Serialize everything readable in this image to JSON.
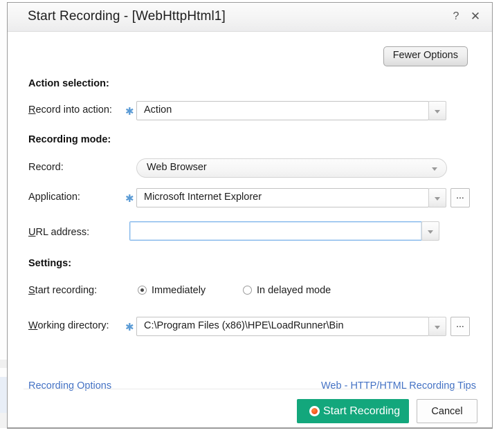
{
  "window": {
    "title": "Start Recording - [WebHttpHtml1]",
    "help_icon": "?",
    "close_icon": "✕"
  },
  "toolbar": {
    "fewer_options_label": "Fewer Options"
  },
  "sections": {
    "action_selection": {
      "heading": "Action selection:",
      "record_into_action": {
        "label_prefix": "R",
        "label_rest": "ecord into action:",
        "required_marker": "✱",
        "value": "Action"
      }
    },
    "recording_mode": {
      "heading": "Recording mode:",
      "record": {
        "label": "Record:",
        "value": "Web Browser"
      },
      "application": {
        "label": "Application:",
        "required_marker": "✱",
        "value": "Microsoft Internet Explorer",
        "browse_label": "..."
      },
      "url_address": {
        "label_prefix": "U",
        "label_rest": "RL address:",
        "value": "",
        "placeholder": ""
      }
    },
    "settings": {
      "heading": "Settings:",
      "start_recording": {
        "label_prefix": "S",
        "label_rest": "tart recording:",
        "options": [
          {
            "label": "Immediately",
            "selected": true
          },
          {
            "label": "In delayed mode",
            "selected": false
          }
        ]
      },
      "working_directory": {
        "label_prefix": "W",
        "label_rest": "orking directory:",
        "required_marker": "✱",
        "value": "C:\\Program Files (x86)\\HPE\\LoadRunner\\Bin",
        "browse_label": "..."
      }
    }
  },
  "links": {
    "recording_options": "Recording Options",
    "recording_tips": "Web - HTTP/HTML Recording Tips"
  },
  "footer": {
    "start_recording_label": "Start Recording",
    "start_recording_icon": "record-dot-icon",
    "cancel_label": "Cancel"
  },
  "colors": {
    "accent_green": "#13a77c",
    "link_blue": "#4472c4",
    "required_star_blue": "#5b9bd5",
    "focus_blue": "#7eb4ea",
    "record_dot_orange": "#f4511e"
  }
}
